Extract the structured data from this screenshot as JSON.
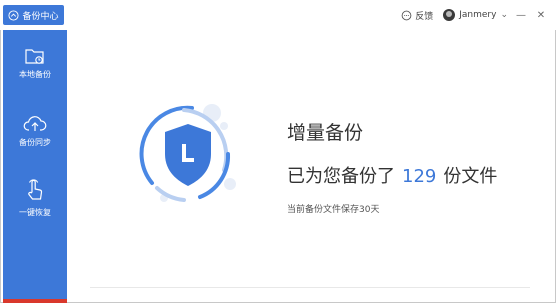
{
  "app": {
    "badge_label": "备份中心"
  },
  "topbar": {
    "feedback_label": "反馈",
    "username": "Janmery",
    "minimize": "—",
    "close": "✕",
    "dropdown": "⌄"
  },
  "sidebar": {
    "items": [
      {
        "label": "本地备份"
      },
      {
        "label": "备份同步"
      },
      {
        "label": "一键恢复"
      }
    ]
  },
  "main": {
    "title": "增量备份",
    "summary_prefix": "已为您备份了",
    "count": "129",
    "summary_suffix": "份文件",
    "retention_note": "当前备份文件保存30天"
  },
  "colors": {
    "accent": "#3d78d8",
    "sidebar_bottom": "#d9382c"
  }
}
